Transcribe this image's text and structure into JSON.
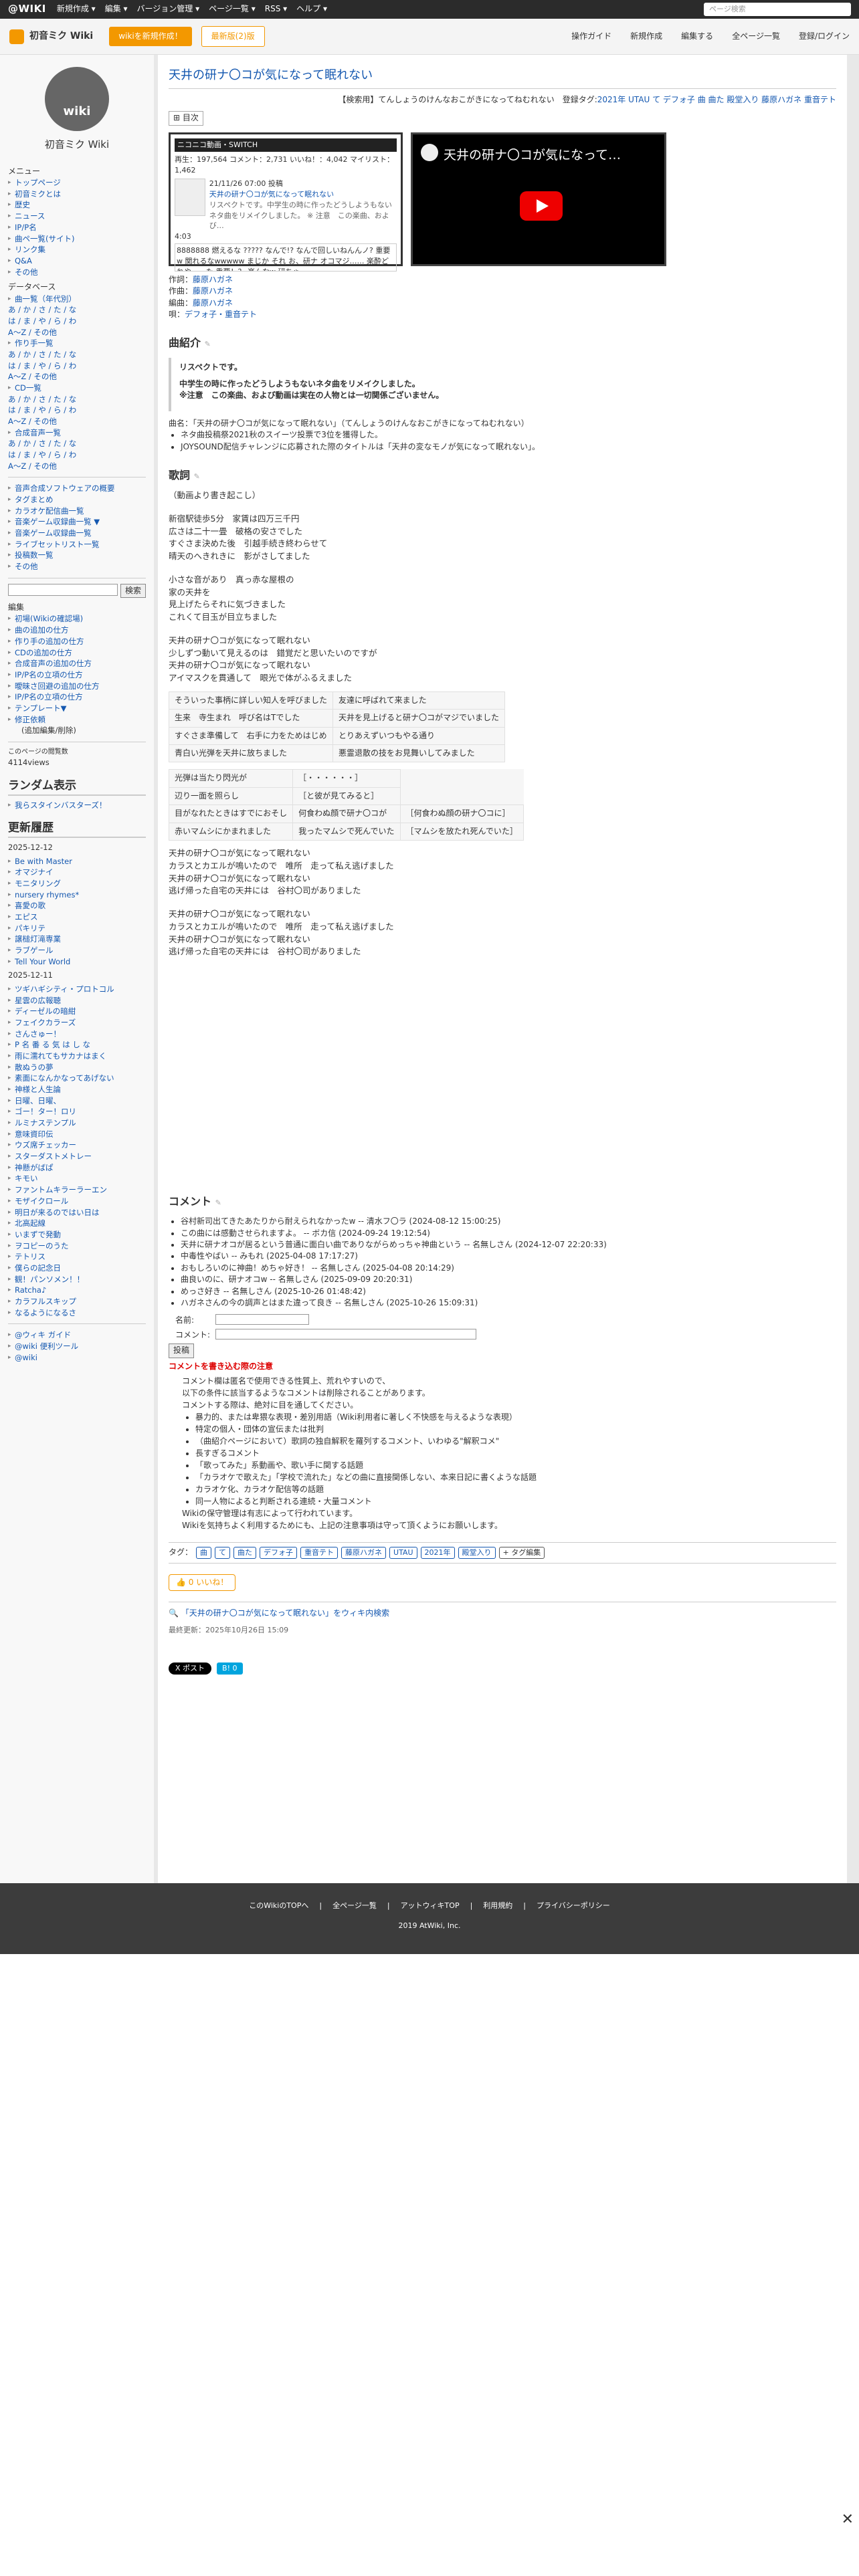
{
  "topbar": {
    "logo": "@WIKI",
    "menus": [
      "新規作成 ▾",
      "編集 ▾",
      "バージョン管理 ▾",
      "ページ一覧 ▾",
      "RSS ▾",
      "ヘルプ ▾"
    ],
    "search_placeholder": "ページ検索"
  },
  "header": {
    "title": "初音ミク Wiki",
    "btn_new": "wikiを新規作成！",
    "btn_edit": "最新版(2)版",
    "links": [
      "操作ガイド",
      "新規作成",
      "編集する",
      "全ページ一覧",
      "登録/ログイン"
    ]
  },
  "side": {
    "wiki_name": "初音ミク Wiki",
    "logo_text": "wiki",
    "menu_h": "メニュー",
    "menu": [
      "トップページ",
      "初音ミクとは",
      "歴史",
      "ニュース",
      "IP/P名",
      "曲ペ一覧(サイト)",
      "リンク集",
      "Q&A",
      "その他"
    ],
    "db_h": "データベース",
    "db1": "曲一覧（年代別）",
    "kana1": "あ / か / さ / た / な",
    "kana2": "は / ま / や / ら / わ",
    "kana3": "A〜Z / その他",
    "db2": "作り手一覧",
    "db3": "CD一覧",
    "db4": "合成音声一覧",
    "misc": [
      "音声合成ソフトウェアの概要",
      "タグまとめ",
      "カラオケ配信曲一覧",
      "音楽ゲーム収録曲一覧 ▼",
      "音楽ゲーム収録曲一覧",
      "ライブセットリスト一覧",
      "投稿数一覧",
      "その他"
    ],
    "search_btn": "検索",
    "edit_h": "編集",
    "edit": [
      "初場(Wikiの確認場)",
      "曲の追加の仕方",
      "作り手の追加の仕方",
      "CDの追加の仕方",
      "合成音声の追加の仕方",
      "IP/P名の立項の仕方",
      "曖昧さ回避の追加の仕方",
      "IP/P名の立項の仕方",
      "テンプレート▼",
      "修正依頼"
    ],
    "edit_sub": "(追加編集/削除)",
    "views_label": "このページの閲覧数",
    "views": "4114views",
    "random_h": "ランダム表示",
    "random": "我らスタインバスターズ！",
    "upd_h": "更新履歴",
    "date1": "2025-12-12",
    "upd1": [
      "Be with Master",
      "オマジナイ",
      "モニタリング",
      "nursery rhymes*",
      "喜愛の歌",
      "エピス",
      "パキリテ",
      "譲槌灯滝専業",
      "ラブゲール",
      "Tell Your World"
    ],
    "date2": "2025-12-11",
    "upd2": [
      "ツギハギシティ・プロトコル",
      "星雲の広報聴",
      "ディーゼルの暗紺",
      "フェイクカラーズ",
      "さんさゅー！",
      "P 名 番 る 気 は し な",
      "雨に濡れてもサカナはまく",
      "散ぬうの夢",
      "素面になんかなってあげない",
      "神様と人生論",
      "日曜、日曜、",
      "ゴー！ター！ロリ",
      "ルミナステンプル",
      "意味資印伝",
      "ウズ席チェッカー",
      "スターダストメトレー",
      "神懸がばぱ",
      "キモい",
      "ファントムキラーラーエン",
      "モザイクロール",
      "明日が来るのではい日は",
      "北高起線",
      "いまずで発動",
      "ヲコピーのうた",
      "テトリス",
      "僕らの記念日",
      "観！パンソメン！！",
      "Ratcha♪",
      "カラフルスキップ",
      "なるようになるさ"
    ],
    "guide": [
      "@ウィキ ガイド",
      "@wiki 便利ツール",
      "@wiki"
    ]
  },
  "main": {
    "title": "天井の研ナ〇コが気になって眠れない",
    "tagline_label": "【検索用】てんしょうのけんなおこがきになってねむれない　登録タグ:",
    "tagline_tags": "2021年 UTAU て デフォ子 曲 曲た 殿堂入り 藤原ハガネ 重音テト",
    "toc": "目次",
    "nico": {
      "head": "ニコニコ動画・SWITCH",
      "stats": "再生：197,564 コメント：2,731 いいね！：4,042 マイリスト：1,462",
      "date": "21/11/26 07:00 投稿",
      "title": "天井の研ナ〇コが気になって眠れない",
      "desc": "リスペクトです。中学生の時に作ったどうしようもないネタ曲をリメイクしました。 ※ 注意　この楽曲、および…",
      "dur": "4:03",
      "comment": "8888888 燃えるな ????? なんで!? なんで回しいねんんノ? 重要w 関れるなwwwww まじか それ お、研ナ オコマジ…… 楽酔どれやーーた 重要！？ 楽んなw 研ちゃ"
    },
    "yt_title": "天井の研ナ〇コが気になって…",
    "credits": [
      {
        "k": "作詞：",
        "v": "藤原ハガネ"
      },
      {
        "k": "作曲：",
        "v": "藤原ハガネ"
      },
      {
        "k": "編曲：",
        "v": "藤原ハガネ"
      },
      {
        "k": "唄：",
        "v": "デフォ子・重音テト"
      }
    ],
    "intro_h": "曲紹介",
    "intro_q1": "リスペクトです。",
    "intro_q2": "中学生の時に作ったどうしようもないネタ曲をリメイクしました。",
    "intro_q3": "※注意　この楽曲、および動画は実在の人物とは一切関係ございません。",
    "intro_songname": "曲名：「天井の研ナ〇コが気になって眠れない」（てんしょうのけんなおこがきになってねむれない）",
    "intro_bullets": [
      "ネタ曲投稿祭2021秋のスイーツ投票で3位を獲得した。",
      "JOYSOUND配信チャレンジに応募された際のタイトルは「天井の変なモノが気になって眠れない」。"
    ],
    "lyrics_h": "歌詞",
    "lyrics_note": "（動画より書き起こし）",
    "lyr1": [
      "新宿駅徒歩5分　家賃は四万三千円",
      "広さは二十一畳　破格の安さでした",
      "すぐさま決めた後　引越手続き終わらせて",
      "晴天のへきれきに　影がさしてました"
    ],
    "lyr2": [
      "小さな音があり　真っ赤な屋根の",
      "家の天井を",
      "見上げたらそれに気づきました",
      "これくて目玉が目立ちました"
    ],
    "lyr3": [
      "天井の研ナ〇コが気になって眠れない",
      "少しずつ動いて見えるのは　錯覚だと思いたいのですが",
      "天井の研ナ〇コが気になって眠れない",
      "アイマスクを貫通して　眼光で体がふるえました"
    ],
    "t1": [
      [
        "そういった事柄に詳しい知人を呼びました",
        "友達に呼ばれて来ました"
      ],
      [
        "生来　寺生まれ　呼び名はTでした",
        "天井を見上げると研ナ〇コがマジでいました"
      ],
      [
        "すぐさま準備して　右手に力をためはじめ",
        "とりあえずいつもやる通り"
      ],
      [
        "青白い光弾を天井に放ちました",
        "悪霊退散の技をお見舞いしてみました"
      ]
    ],
    "t2": [
      [
        "光弾は当たり閃光が",
        "［・・・・・・］"
      ],
      [
        "辺り一面を照らし",
        "［と彼が見てみると］"
      ],
      [
        "目がなれたときはすでにおそし",
        "何食わぬ顔で研ナ〇コが",
        "［何食わぬ顔の研ナ〇コに］"
      ],
      [
        "赤いマムシにかまれました",
        "我ったマムシで死んでいた",
        "［マムシを放たれ死んでいた］"
      ]
    ],
    "lyr4": [
      "天井の研ナ〇コが気になって眠れない",
      "カラスとカエルが鳴いたので　唯所　走って私え逃げました",
      "天井の研ナ〇コが気になって眠れない",
      "逃げ帰った自宅の天井には　谷村〇司がありました"
    ],
    "lyr5": [
      "天井の研ナ〇コが気になって眠れない",
      "カラスとカエルが鳴いたので　唯所　走って私え逃げました",
      "天井の研ナ〇コが気になって眠れない",
      "逃げ帰った自宅の天井には　谷村〇司がありました"
    ],
    "comment_h": "コメント",
    "comments": [
      "谷村新司出てきたあたりから耐えられなかったw -- 清水フ〇ラ (2024-08-12 15:00:25)",
      "この曲には感動させられますよ。 -- ボカ信 (2024-09-24 19:12:54)",
      "天井に研ナオコが居るという普通に面白い曲でありながらめっちゃ神曲という -- 名無しさん (2024-12-07 22:20:33)",
      "中毒性やばい -- みもれ (2025-04-08 17:17:27)",
      "おもしろいのに神曲！めちゃ好き！ -- 名無しさん (2025-04-08 20:14:29)",
      "曲良いのに、研ナオコw -- 名無しさん (2025-09-09 20:20:31)",
      "めっさ好き -- 名無しさん (2025-10-26 01:48:42)",
      "ハガネさんの今の調声とはまた違って良き -- 名無しさん (2025-10-26 15:09:31)"
    ],
    "form_name": "名前:",
    "form_comment": "コメント:",
    "form_btn": "投稿",
    "rules_h": "コメントを書き込む際の注意",
    "rules1": [
      "コメント欄は匿名で使用できる性質上、荒れやすいので、",
      "以下の条件に該当するようなコメントは削除されることがあります。",
      "コメントする際は、絶対に目を通してください。"
    ],
    "rules_list": [
      "暴力的、または卑猥な表現・差別用語（Wiki利用者に著しく不快感を与えるような表現）",
      "特定の個人・団体の宣伝または批判",
      "（曲紹介ページにおいて）歌詞の独自解釈を羅列するコメント、いわゆる\"解釈コメ\"",
      "長すぎるコメント",
      "「歌ってみた」系動画や、歌い手に関する話題",
      "「カラオケで歌えた」「学校で流れた」などの曲に直接関係しない、本来日記に書くような話題",
      "カラオケ化、カラオケ配信等の話題",
      "同一人物によると判断される連続・大量コメント"
    ],
    "rules2": [
      "Wikiの保守管理は有志によって行われています。",
      "Wikiを気持ちよく利用するためにも、上記の注意事項は守って頂くようにお願いします。"
    ],
    "tag_label": "タグ：",
    "tags": [
      "曲",
      "て",
      "曲た",
      "デフォ子",
      "重音テト",
      "藤原ハガネ",
      "UTAU",
      "2021年",
      "殿堂入り"
    ],
    "tag_edit": "+ タグ編集",
    "like": "0 いいね！",
    "search_link": "「天井の研ナ〇コが気になって眠れない」をウィキ内検索",
    "updated": "最終更新：2025年10月26日 15:09",
    "post_btn": "X ポスト",
    "hatena_btn": "B! 0"
  },
  "footer": {
    "links": [
      "このWikiのTOPへ",
      "全ページ一覧",
      "アットウィキTOP",
      "利用規約",
      "プライバシーポリシー"
    ],
    "copy": "2019 AtWiki, Inc."
  }
}
